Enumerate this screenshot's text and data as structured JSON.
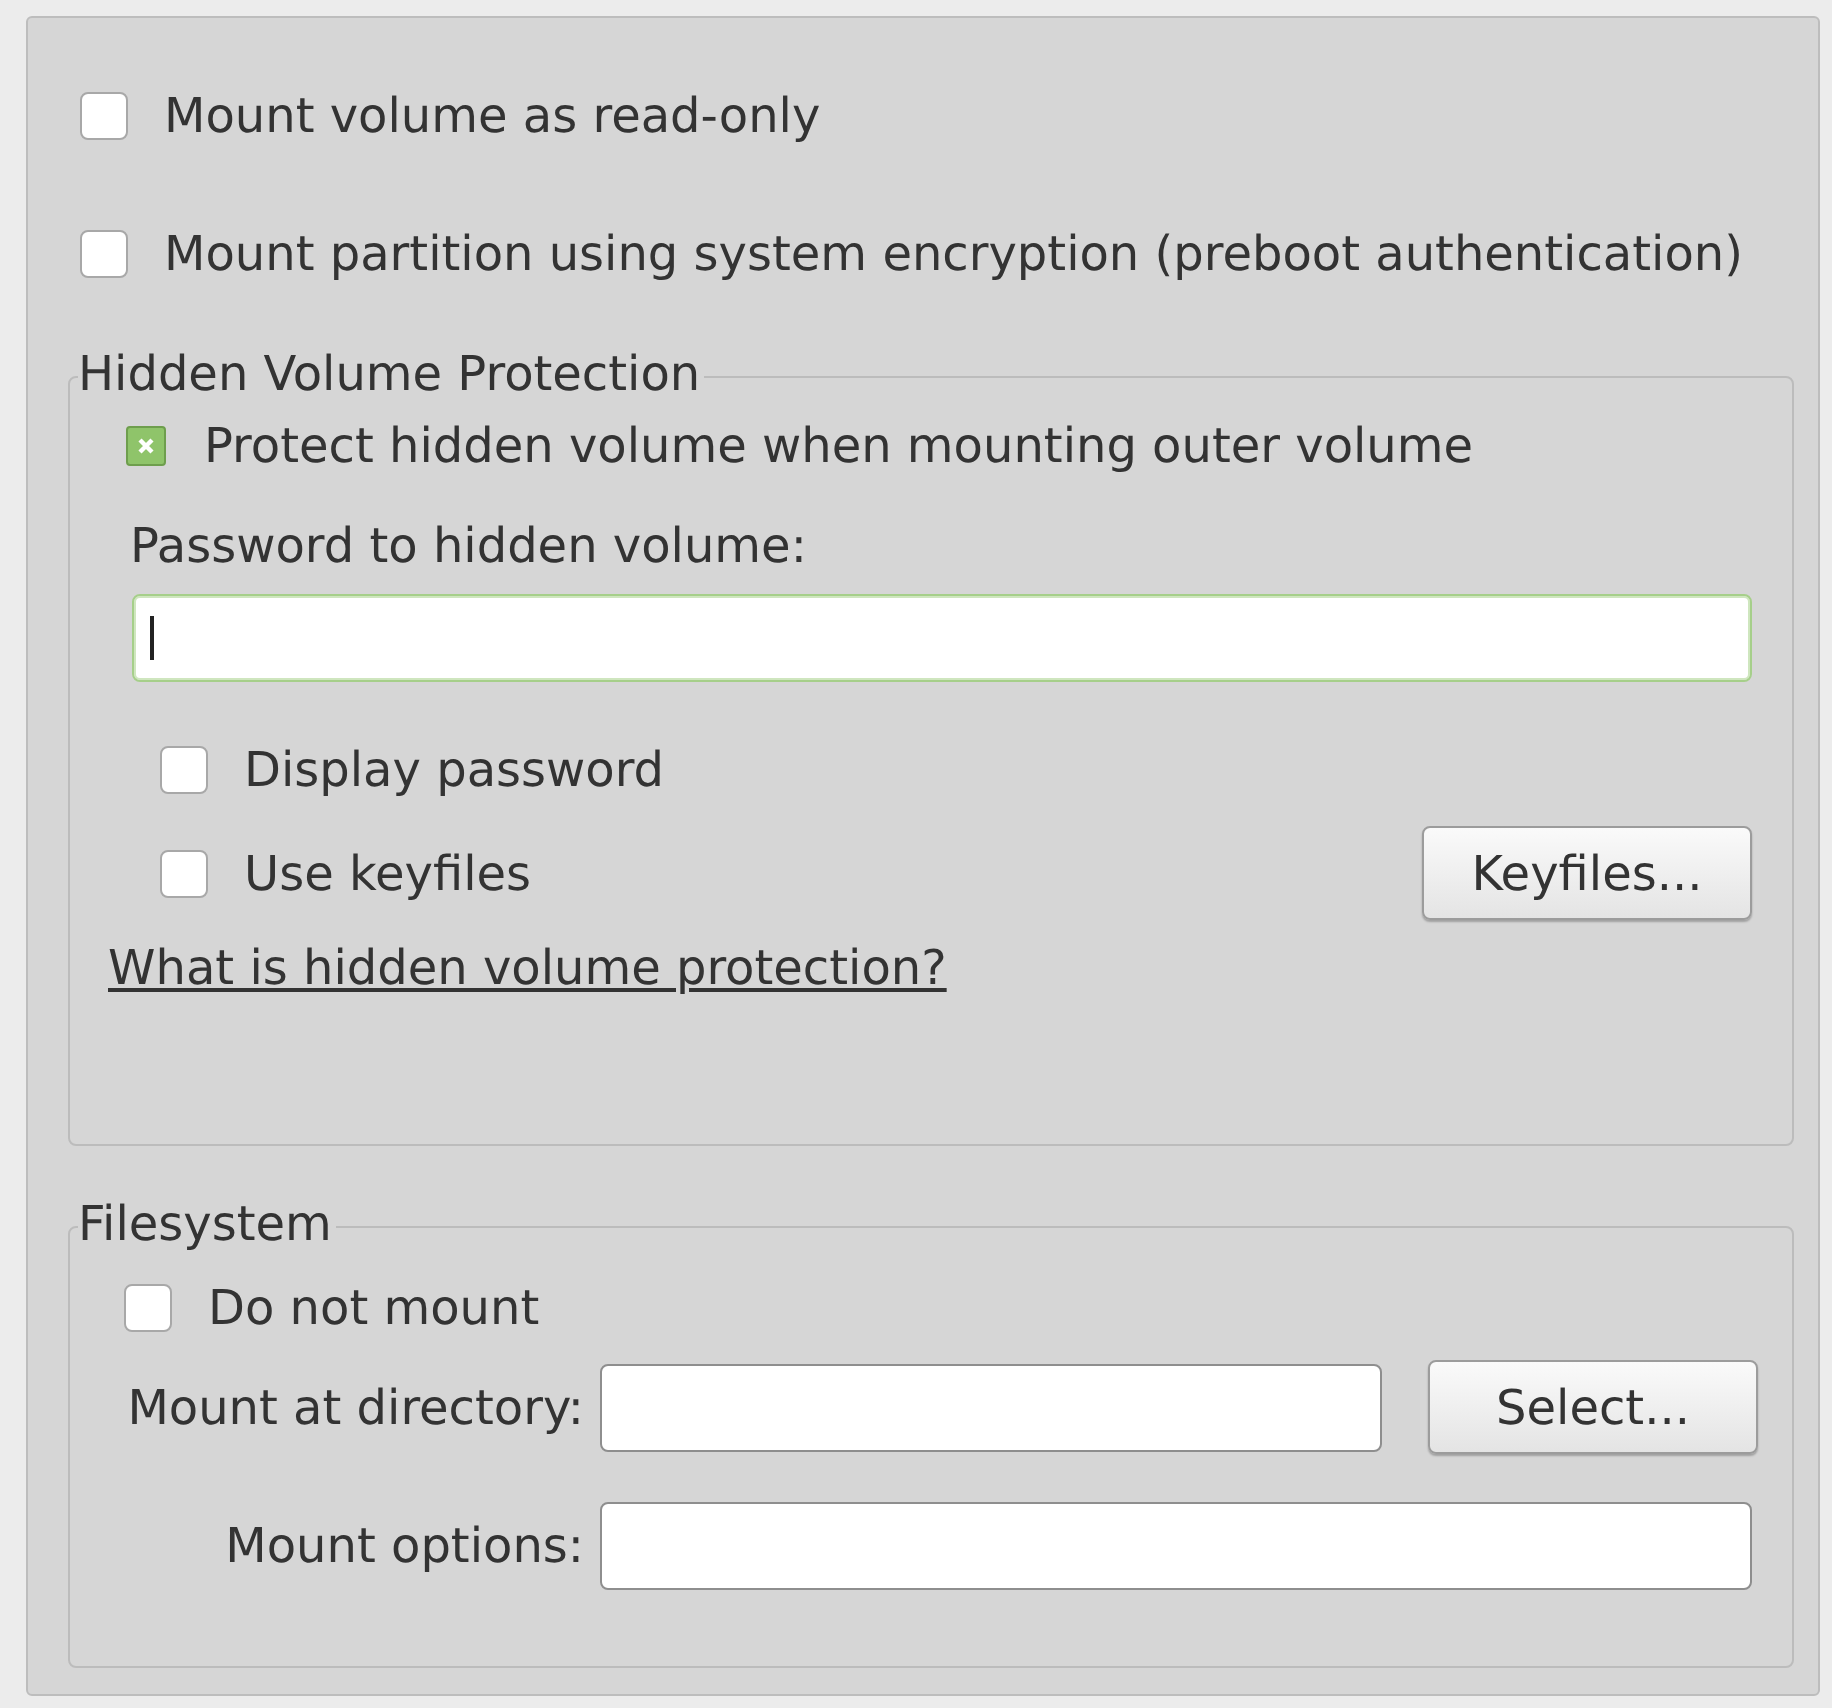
{
  "options": [
    {
      "label": "Mount volume as read-only",
      "checked": false
    },
    {
      "label": "Mount partition using system encryption (preboot authentication)",
      "checked": false
    }
  ],
  "hidden_volume_protection": {
    "title": "Hidden Volume Protection",
    "protect": {
      "label": "Protect hidden volume when mounting outer volume",
      "checked": true
    },
    "password_label": "Password to hidden volume:",
    "password_field": {
      "focused": true
    },
    "display_password": {
      "label": "Display password",
      "checked": false
    },
    "use_keyfiles": {
      "label": "Use keyfiles",
      "checked": false
    },
    "keyfiles_button": "Keyfiles...",
    "help_link": "What is hidden volume protection?"
  },
  "filesystem": {
    "title": "Filesystem",
    "do_not_mount": {
      "label": "Do not mount",
      "checked": false
    },
    "mount_directory_label": "Mount at directory:",
    "select_button": "Select...",
    "mount_options_label": "Mount options:"
  }
}
